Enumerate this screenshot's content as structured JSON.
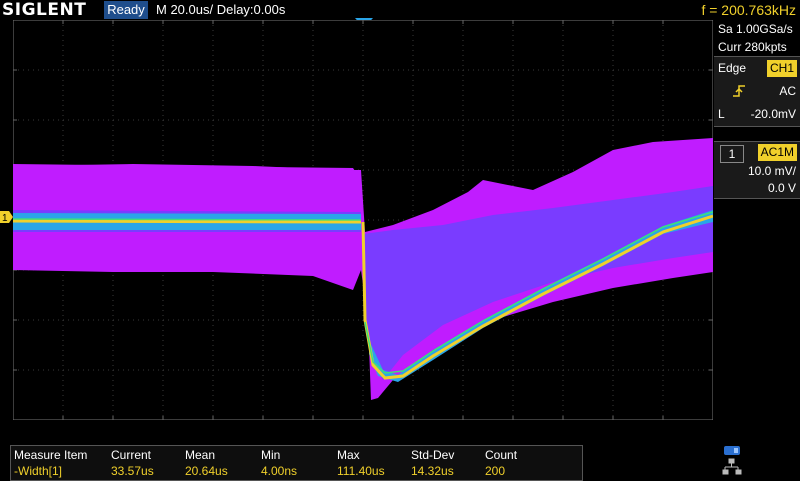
{
  "header": {
    "brand": "SIGLENT",
    "status": "Ready",
    "timebase": "M 20.0us/  Delay:0.00s",
    "frequency": "f = 200.763kHz"
  },
  "acquisition": {
    "sample_rate": "Sa 1.00GSa/s",
    "memory": "Curr 280kpts"
  },
  "trigger": {
    "type": "Edge",
    "source": "CH1",
    "slope_icon": "rising-edge-icon",
    "coupling": "AC",
    "level_label": "L",
    "level": "-20.0mV"
  },
  "channel": {
    "number": "1",
    "coupling": "AC1M",
    "scale": "10.0 mV/",
    "offset": "0.0 V",
    "color": "#f0d02b"
  },
  "measure": {
    "headers": [
      "Measure Item",
      "Current",
      "Mean",
      "Min",
      "Max",
      "Std-Dev",
      "Count"
    ],
    "row": [
      "-Width[1]",
      "33.57us",
      "20.64us",
      "4.00ns",
      "111.40us",
      "14.32us",
      "200"
    ]
  },
  "colors": {
    "persistence_outer": "#c01cff",
    "persistence_mid": "#7a3cff",
    "persistence_inner": "#2aa5e8",
    "trace_core": "#f0d02b",
    "trigger_marker": "#2aa5e8",
    "ready_bg": "#1f4e8c"
  }
}
